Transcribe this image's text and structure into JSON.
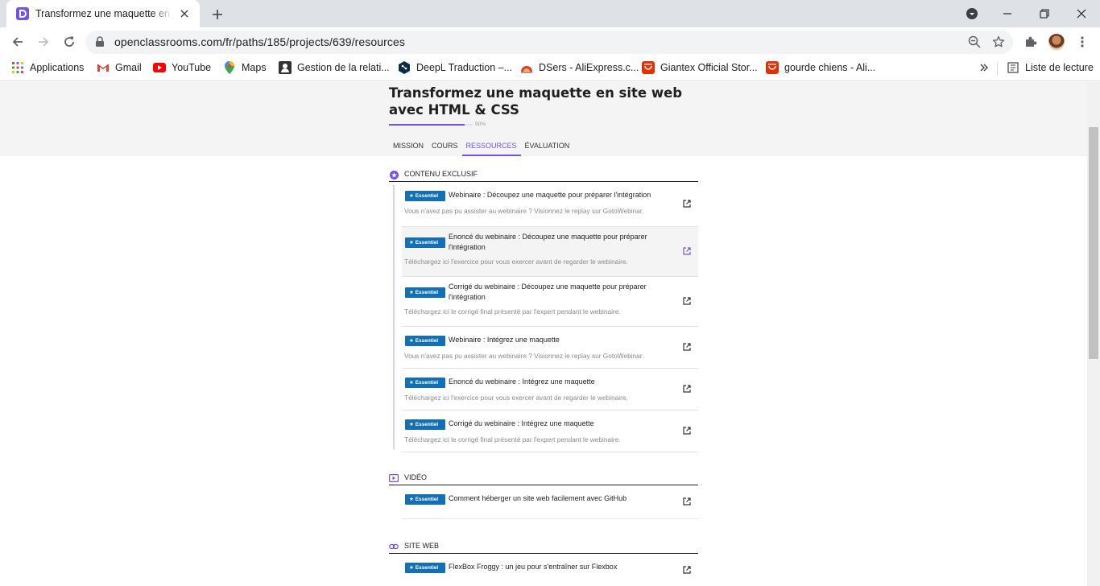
{
  "browser": {
    "tab_title": "Transformez une maquette en site web avec HTML & CSS",
    "url": "openclassrooms.com/fr/paths/185/projects/639/resources"
  },
  "bookmarks": [
    {
      "label": "Applications",
      "icon": "apps-grid-icon"
    },
    {
      "label": "Gmail",
      "icon": "gmail-icon"
    },
    {
      "label": "YouTube",
      "icon": "youtube-icon"
    },
    {
      "label": "Maps",
      "icon": "maps-icon"
    },
    {
      "label": "Gestion de la relati...",
      "icon": "crm-icon"
    },
    {
      "label": "DeepL Traduction –...",
      "icon": "deepl-icon"
    },
    {
      "label": "DSers - AliExpress.c...",
      "icon": "dsers-icon"
    },
    {
      "label": "Giantex Official Stor...",
      "icon": "aliexpress-icon"
    },
    {
      "label": "gourde chiens - Ali...",
      "icon": "aliexpress-icon"
    }
  ],
  "reading_list_label": "Liste de lecture",
  "course": {
    "title": "Transformez une maquette en site web avec HTML & CSS",
    "progress_label": "90%",
    "progress_fraction": 0.9,
    "tabs": [
      "MISSION",
      "COURS",
      "RESSOURCES",
      "ÉVALUATION"
    ],
    "active_tab": "RESSOURCES"
  },
  "badge_label": "★ Essentiel",
  "sections": [
    {
      "label": "CONTENU EXCLUSIF",
      "icon": "star-circle-icon",
      "items": [
        {
          "title": "Webinaire : Découpez une maquette pour préparer l'intégration",
          "desc": "Vous n'avez pas pu assister au webinaire ? Visionnez le replay sur GotoWebinar."
        },
        {
          "title": "Enoncé du webinaire : Découpez une maquette pour préparer l'intégration",
          "desc": "Téléchargez ici l'exercice pour vous exercer avant de regarder le webinaire."
        },
        {
          "title": "Corrigé du webinaire : Découpez une maquette pour préparer l'intégration",
          "desc": "Téléchargez ici le corrigé final présenté par l'expert pendant le webinaire."
        },
        {
          "title": "Webinaire : Intégrez une maquette",
          "desc": "Vous n'avez pas pu assister au webinaire ? Visionnez le replay sur GotoWebinar."
        },
        {
          "title": "Enoncé du webinaire : Intégrez une maquette",
          "desc": "Téléchargez ici l'exercice pour vous exercer avant de regarder le webinaire."
        },
        {
          "title": "Corrigé du webinaire : Intégrez une maquette",
          "desc": "Téléchargez ici le corrigé final présenté par l'expert pendant le webinaire."
        }
      ]
    },
    {
      "label": "VIDÉO",
      "icon": "video-play-icon",
      "items": [
        {
          "title": "Comment héberger un site web facilement avec GitHub",
          "desc": ""
        }
      ]
    },
    {
      "label": "SITE WEB",
      "icon": "link-icon",
      "items": [
        {
          "title": "FlexBox Froggy : un jeu pour s'entraîner sur Flexbox",
          "desc": ""
        }
      ]
    }
  ],
  "colors": {
    "accent": "#7451eb",
    "badge": "#1270b8",
    "hero_bg": "#f4f4f4"
  }
}
